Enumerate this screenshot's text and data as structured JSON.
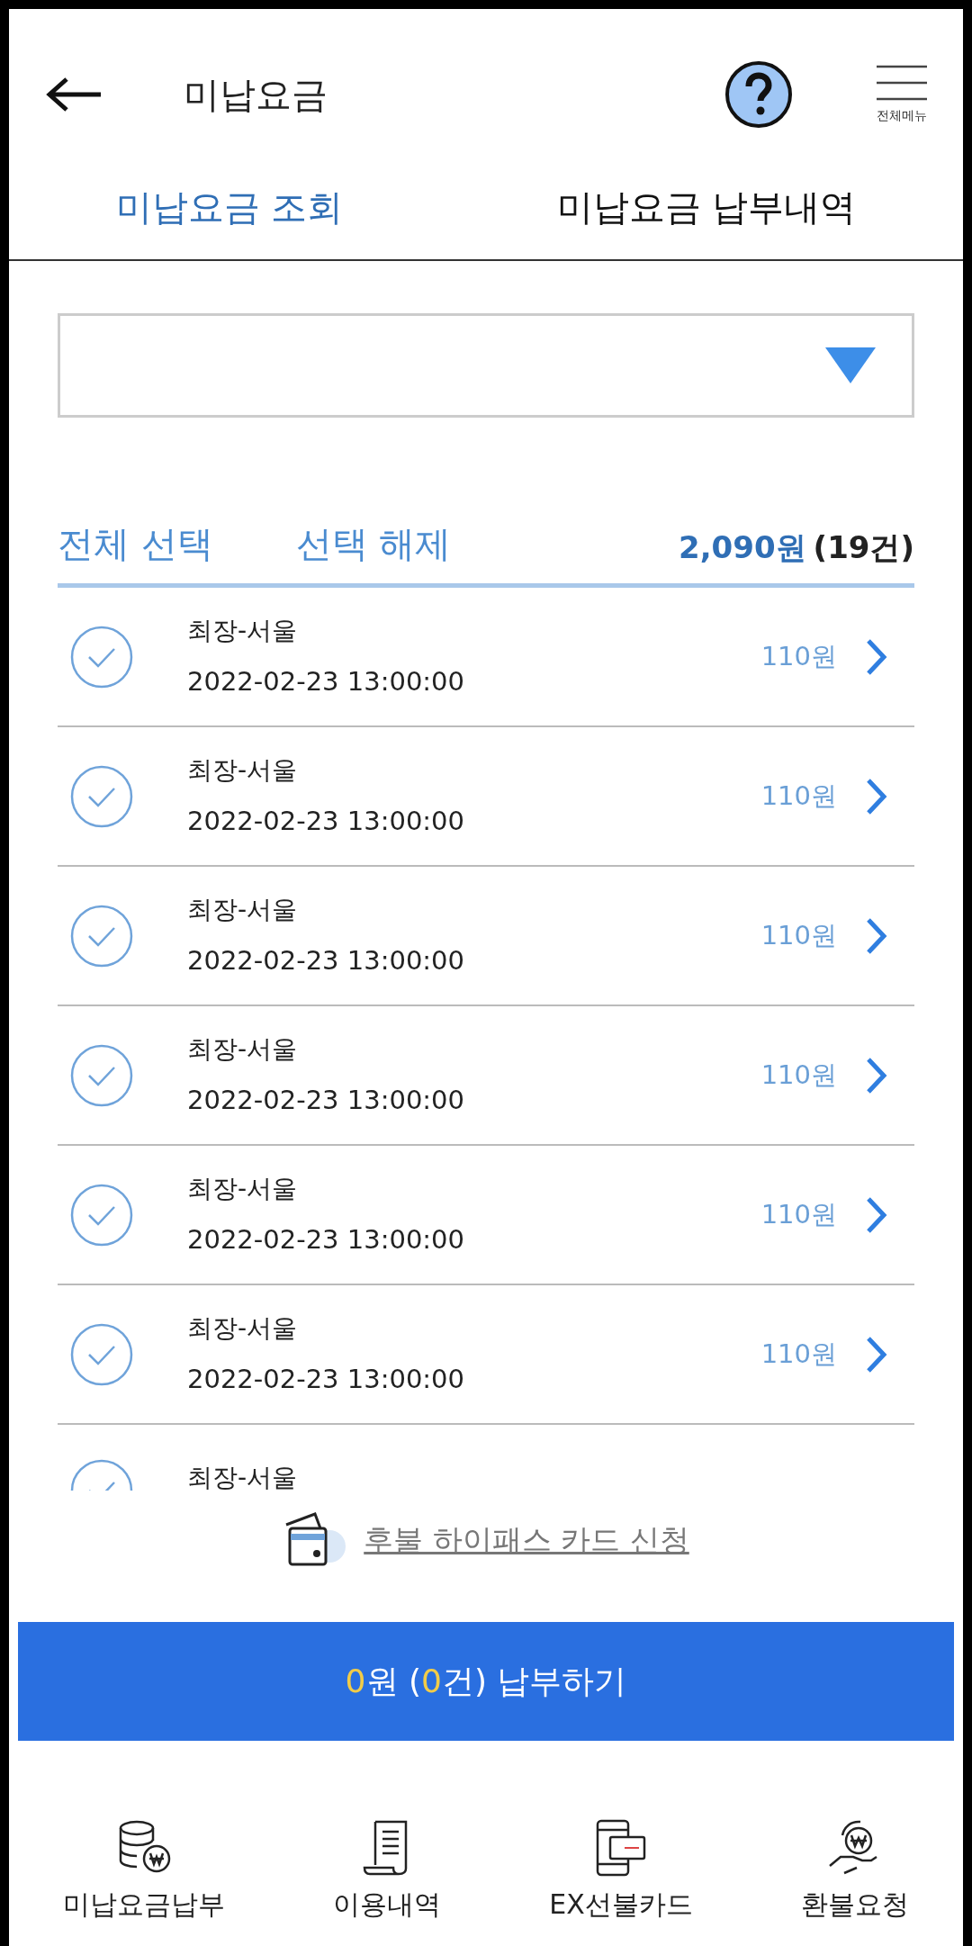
{
  "header": {
    "title": "미납요금",
    "menu_label": "전체메뉴"
  },
  "tabs": [
    {
      "label": "미납요금 조회",
      "selected": true
    },
    {
      "label": "미납요금 납부내역",
      "selected": false
    }
  ],
  "selection": {
    "select_all": "전체 선택",
    "deselect": "선택 해제",
    "total_amount": "2,090원",
    "total_count": "(19건)"
  },
  "items": [
    {
      "name": "최장-서울",
      "datetime": "2022-02-23 13:00:00",
      "amount": "110원",
      "checked": false
    },
    {
      "name": "최장-서울",
      "datetime": "2022-02-23 13:00:00",
      "amount": "110원",
      "checked": false
    },
    {
      "name": "최장-서울",
      "datetime": "2022-02-23 13:00:00",
      "amount": "110원",
      "checked": false
    },
    {
      "name": "최장-서울",
      "datetime": "2022-02-23 13:00:00",
      "amount": "110원",
      "checked": false
    },
    {
      "name": "최장-서울",
      "datetime": "2022-02-23 13:00:00",
      "amount": "110원",
      "checked": false
    },
    {
      "name": "최장-서울",
      "datetime": "2022-02-23 13:00:00",
      "amount": "110원",
      "checked": false
    },
    {
      "name": "최장-서울",
      "checked": false
    }
  ],
  "card_link": "후불 하이패스 카드 신청",
  "pay_button": [
    {
      "text": "0",
      "highlight": true
    },
    {
      "text": "원 (",
      "highlight": false
    },
    {
      "text": "0",
      "highlight": true
    },
    {
      "text": "건) 납부하기",
      "highlight": false
    }
  ],
  "bottom_nav": [
    {
      "label": "미납요금납부",
      "kind": "coins"
    },
    {
      "label": "이용내역",
      "kind": "receipt"
    },
    {
      "label": "EX선불카드",
      "kind": "phone-card"
    },
    {
      "label": "환불요청",
      "kind": "refund"
    }
  ]
}
